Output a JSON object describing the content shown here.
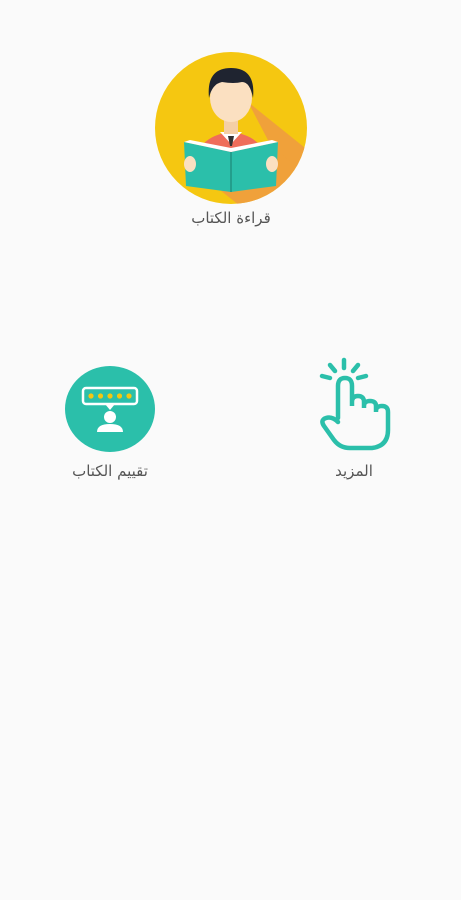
{
  "tiles": {
    "read_book": {
      "label": "قراءة الكتاب",
      "icon": "reading-boy-icon",
      "color": "#f5c711"
    },
    "rate_book": {
      "label": "تقييم الكتاب",
      "icon": "rating-review-icon",
      "color": "#2bbfaa"
    },
    "more": {
      "label": "المزيد",
      "icon": "tap-hand-icon",
      "color": "#2bbfaa"
    }
  }
}
